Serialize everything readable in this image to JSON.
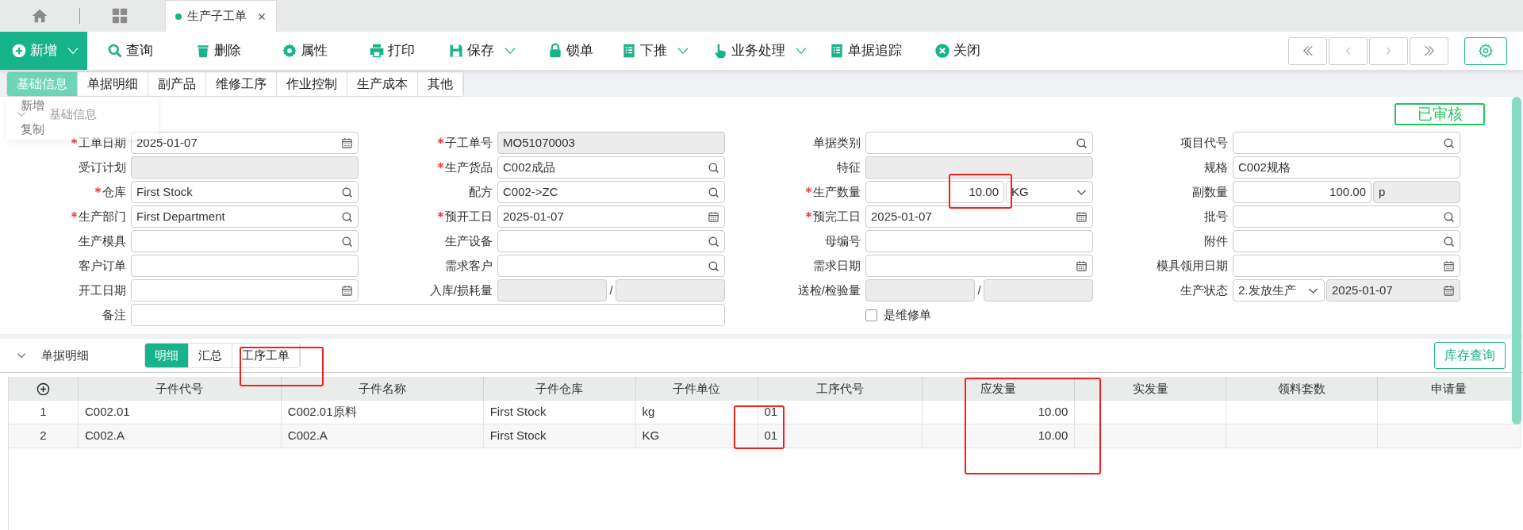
{
  "window_tabs": [
    {
      "label": "生产子工单",
      "selected": true
    }
  ],
  "toolbar": [
    {
      "label": "新增",
      "dropdown": true,
      "kind": "primary"
    },
    {
      "label": "查询",
      "dropdown": false,
      "kind": "plain"
    },
    {
      "label": "删除",
      "dropdown": false,
      "kind": "plain"
    },
    {
      "label": "属性",
      "dropdown": false,
      "kind": "plain"
    },
    {
      "label": "打印",
      "dropdown": false,
      "kind": "plain"
    },
    {
      "label": "保存",
      "dropdown": true,
      "kind": "plain"
    },
    {
      "label": "锁单",
      "dropdown": false,
      "kind": "plain"
    },
    {
      "label": "下推",
      "dropdown": true,
      "kind": "plain"
    },
    {
      "label": "业务处理",
      "dropdown": true,
      "kind": "plain"
    },
    {
      "label": "单据追踪",
      "dropdown": false,
      "kind": "plain"
    },
    {
      "label": "关闭",
      "dropdown": false,
      "kind": "plain"
    }
  ],
  "section_tabs": [
    {
      "label": "基础信息",
      "selected": true
    },
    {
      "label": "单据明细",
      "selected": false
    },
    {
      "label": "副产品",
      "selected": false
    },
    {
      "label": "维修工序",
      "selected": false
    },
    {
      "label": "作业控制",
      "selected": false
    },
    {
      "label": "生产成本",
      "selected": false
    },
    {
      "label": "其他",
      "selected": false
    }
  ],
  "context_menu": {
    "items": [
      "新增",
      "复制"
    ]
  },
  "basic_section": {
    "title": "基础信息",
    "expanded": true,
    "status": "已审核"
  },
  "form_rows": [
    [
      {
        "label": "工单日期",
        "required": true,
        "kind": "date",
        "value": "2025-01-07"
      },
      {
        "label": "子工单号",
        "required": true,
        "kind": "readonly",
        "value": "MO51070003"
      },
      {
        "label": "单据类别",
        "required": false,
        "kind": "lookup"
      },
      {
        "label": "项目代号",
        "required": false,
        "kind": "lookup"
      }
    ],
    [
      {
        "label": "受订计划",
        "required": false,
        "kind": "readonly"
      },
      {
        "label": "生产货品",
        "required": true,
        "kind": "lookup",
        "value": "C002成品"
      },
      {
        "label": "特征",
        "required": false,
        "kind": "readonly"
      },
      {
        "label": "规格",
        "required": false,
        "kind": "text",
        "value": "C002规格"
      }
    ],
    [
      {
        "label": "仓库",
        "required": true,
        "kind": "lookup",
        "value": "First Stock"
      },
      {
        "label": "配方",
        "required": false,
        "kind": "lookup",
        "value": "C002->ZC"
      },
      {
        "label": "生产数量",
        "required": true,
        "kind": "qty_unit",
        "value": "10.00",
        "unit": {
          "value": "KG",
          "kind": "select"
        }
      },
      {
        "label": "副数量",
        "required": false,
        "kind": "qty_unit",
        "value": "100.00",
        "unit": {
          "value": "p",
          "kind": "readonly"
        }
      }
    ],
    [
      {
        "label": "生产部门",
        "required": true,
        "kind": "lookup",
        "value": "First Department"
      },
      {
        "label": "预开工日",
        "required": true,
        "kind": "date",
        "value": "2025-01-07"
      },
      {
        "label": "预完工日",
        "required": true,
        "kind": "date",
        "value": "2025-01-07"
      },
      {
        "label": "批号",
        "required": false,
        "kind": "lookup"
      }
    ],
    [
      {
        "label": "生产模具",
        "required": false,
        "kind": "lookup"
      },
      {
        "label": "生产设备",
        "required": false,
        "kind": "lookup"
      },
      {
        "label": "母编号",
        "required": false,
        "kind": "text"
      },
      {
        "label": "附件",
        "required": false,
        "kind": "lookup"
      }
    ],
    [
      {
        "label": "客户订单",
        "required": false,
        "kind": "text"
      },
      {
        "label": "需求客户",
        "required": false,
        "kind": "lookup"
      },
      {
        "label": "需求日期",
        "required": false,
        "kind": "date"
      },
      {
        "label": "模具领用日期",
        "required": false,
        "kind": "date"
      }
    ],
    [
      {
        "label": "开工日期",
        "required": false,
        "kind": "date"
      },
      {
        "label": "入库/损耗量",
        "required": false,
        "kind": "split",
        "separator": "/"
      },
      {
        "label": "送检/检验量",
        "required": false,
        "kind": "split",
        "separator": "/"
      },
      {
        "label": "生产状态",
        "required": false,
        "kind": "status",
        "value": "2.发放生产",
        "date": "2025-01-07"
      }
    ],
    [
      {
        "label": "备注",
        "required": false,
        "kind": "wide"
      },
      {
        "label": "是维修单",
        "kind": "checkbox",
        "checked": false
      }
    ]
  ],
  "detail_section": {
    "title": "单据明细",
    "expanded": true,
    "views": [
      {
        "label": "明细",
        "selected": true
      },
      {
        "label": "汇总",
        "selected": false
      },
      {
        "label": "工序工单",
        "selected": false
      }
    ],
    "stock_button": "库存查询"
  },
  "table": {
    "columns": [
      {
        "label": "子件代号",
        "kind": "text"
      },
      {
        "label": "子件名称",
        "kind": "text"
      },
      {
        "label": "子件仓库",
        "kind": "text"
      },
      {
        "label": "子件单位",
        "kind": "text"
      },
      {
        "label": "工序代号",
        "kind": "text"
      },
      {
        "label": "应发量",
        "kind": "number"
      },
      {
        "label": "实发量",
        "kind": "number"
      },
      {
        "label": "领料套数",
        "kind": "number"
      },
      {
        "label": "申请量",
        "kind": "number"
      }
    ],
    "rows": [
      {
        "index": "1",
        "cells": [
          "C002.01",
          "C002.01原料",
          "First Stock",
          "kg",
          "01",
          "10.00",
          "",
          "",
          ""
        ]
      },
      {
        "index": "2",
        "cells": [
          "C002.A",
          "C002.A",
          "First Stock",
          "KG",
          "01",
          "10.00",
          "",
          "",
          ""
        ]
      }
    ]
  }
}
